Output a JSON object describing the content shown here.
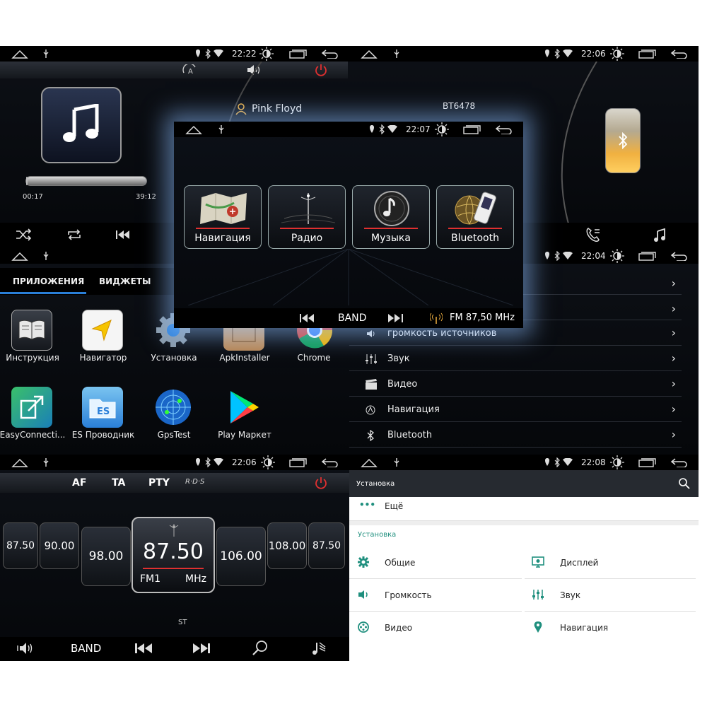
{
  "colors": {
    "accent_blue": "#2a7fd8",
    "accent_red": "#e03030",
    "teal": "#1f8f7e",
    "amber": "#f0b040"
  },
  "music": {
    "time": "22:22",
    "artist": "Pink Floyd",
    "elapsed": "00:17",
    "total": "39:12",
    "progress": 0.01
  },
  "bt": {
    "time": "22:06",
    "device": "BT6478"
  },
  "apps": {
    "tabs": [
      "ПРИЛОЖЕНИЯ",
      "ВИДЖЕТЫ"
    ],
    "items": [
      "Инструкция",
      "Навигатор",
      "Установка",
      "ApkInstaller",
      "Chrome",
      "EasyConnecti...",
      "ES Проводник",
      "GpsTest",
      "Play Маркет"
    ]
  },
  "settings1": {
    "time": "22:04",
    "items": [
      "громкость источников",
      "Звук",
      "Видео",
      "Навигация",
      "Bluetooth"
    ]
  },
  "radio": {
    "time": "22:06",
    "top_buttons": [
      "AF",
      "TA",
      "PTY"
    ],
    "rds": "R·D·S",
    "frequencies": [
      "87.50",
      "90.00",
      "98.00",
      "87.50",
      "106.00",
      "108.00",
      "87.50"
    ],
    "current": "87.50",
    "band": "FM1",
    "unit": "MHz",
    "stereo": "ST",
    "band_label": "BAND"
  },
  "settings2": {
    "time": "22:08",
    "title": "Установка",
    "more": "Ещё",
    "section": "Установка",
    "items": [
      "Общие",
      "Дисплей",
      "Громкость",
      "Звук",
      "Видео",
      "Навигация"
    ]
  },
  "main": {
    "time": "22:07",
    "tiles": [
      "Навигация",
      "Радио",
      "Музыка",
      "Bluetooth"
    ],
    "band_label": "BAND",
    "station": "FM 87,50 MHz"
  }
}
